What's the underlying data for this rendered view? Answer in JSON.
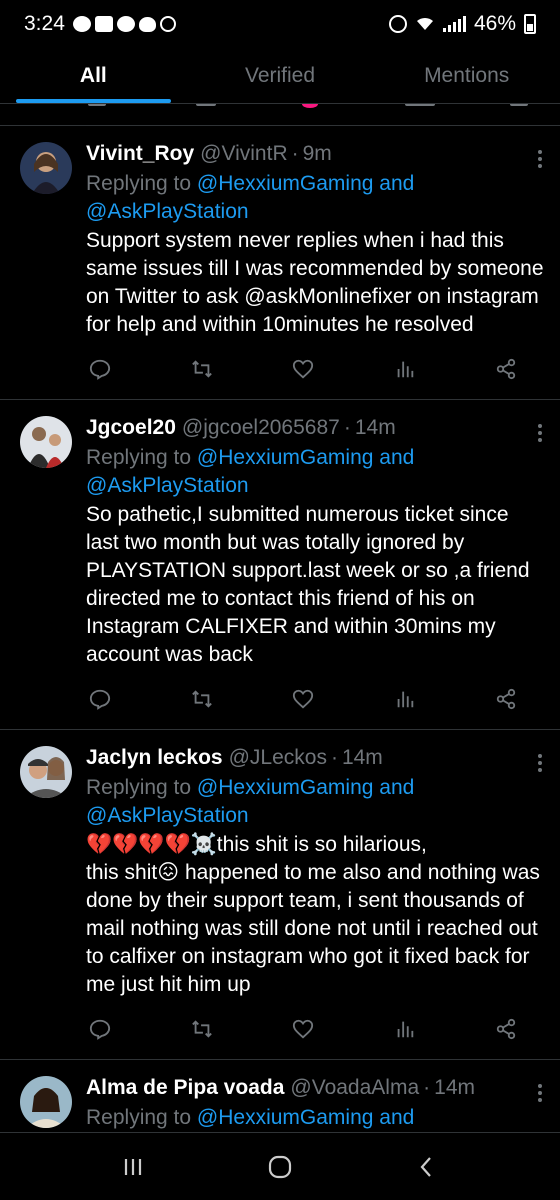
{
  "status": {
    "time": "3:24",
    "battery": "46%",
    "notification_icons": [
      "chat-bubble-icon",
      "mail-icon",
      "message-icon",
      "heart-icon",
      "sync-icon"
    ]
  },
  "tabs": [
    {
      "label": "All",
      "active": true
    },
    {
      "label": "Verified",
      "active": false
    },
    {
      "label": "Mentions",
      "active": false
    }
  ],
  "tweets": [
    {
      "display_name": "Vivint_Roy",
      "handle": "@VivintR",
      "time": "9m",
      "replying_prefix": "Replying to",
      "replying_to_1": "@HexxiumGaming and",
      "replying_to_2": "@AskPlayStation",
      "text": "Support system never replies when i had this same issues till I was recommended by someone on Twitter to ask @askMonlinefixer on instagram for help and within 10minutes he resolved"
    },
    {
      "display_name": "Jgcoel20",
      "handle": "@jgcoel2065687",
      "time": "14m",
      "replying_prefix": "Replying to",
      "replying_to_1": "@HexxiumGaming and",
      "replying_to_2": "@AskPlayStation",
      "text": "So pathetic,I submitted numerous ticket since last two month but was totally ignored by PLAYSTATION support.last week or so ,a friend directed me to contact this friend of his on Instagram CALFIXER and within 30mins my account was back"
    },
    {
      "display_name": "Jaclyn leckos",
      "handle": "@JLeckos",
      "time": "14m",
      "replying_prefix": "Replying to",
      "replying_to_1": "@HexxiumGaming and",
      "replying_to_2": "@AskPlayStation",
      "emoji_prefix": "💔💔💔💔☠️",
      "text_line1": "this shit is so hilarious,",
      "text_part2_a": "this shit",
      "emoji_mid": "😖",
      "text_part2_b": " happened to me also and nothing was done by their  support team, i sent thousands of mail nothing was still done not until i reached out to calfixer on instagram who got it fixed back for me just hit him up"
    },
    {
      "display_name": "Alma de Pipa voada",
      "handle": "@VoadaAlma",
      "time": "14m",
      "replying_prefix": "Replying to",
      "replying_to_1": "@HexxiumGaming and"
    }
  ],
  "colors": {
    "background": "#000000",
    "accent": "#1d9bf0",
    "muted": "#71767b",
    "divider": "#2f3336"
  }
}
